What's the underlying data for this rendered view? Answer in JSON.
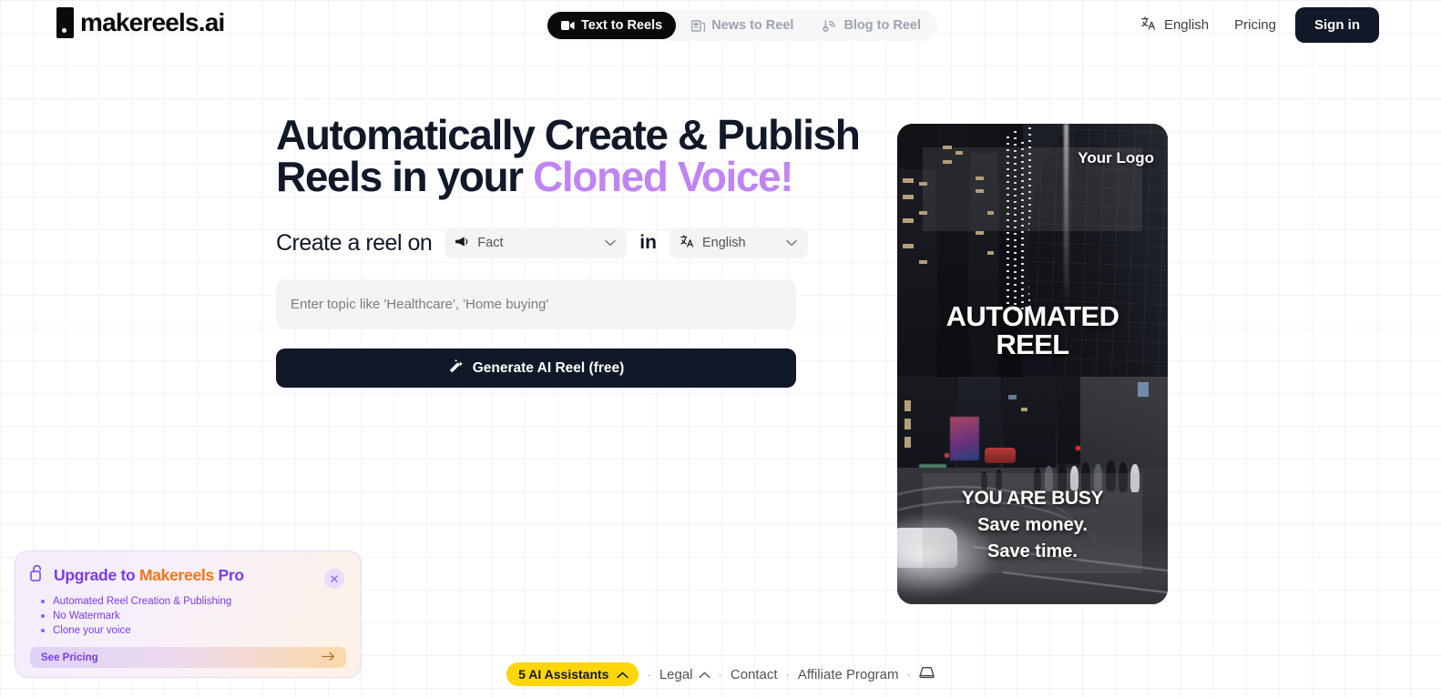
{
  "header": {
    "logo_text": "makereels.ai",
    "tabs": [
      {
        "label": "Text to Reels",
        "icon": "video-camera-icon",
        "active": true
      },
      {
        "label": "News to Reel",
        "icon": "newspaper-icon",
        "active": false
      },
      {
        "label": "Blog to Reel",
        "icon": "blog-rss-icon",
        "active": false
      }
    ],
    "language": "English",
    "pricing": "Pricing",
    "sign_in": "Sign in"
  },
  "hero": {
    "headline_line1": "Automatically Create & Publish",
    "headline_line2_prefix": "Reels in your ",
    "headline_accent": "Cloned Voice!",
    "accent_color": "#c084f5",
    "form": {
      "label_prefix": "Create a reel on",
      "topic_type": "Fact",
      "label_in": "in",
      "language": "English",
      "input_placeholder": "Enter topic like 'Healthcare', 'Home buying'",
      "input_value": "",
      "generate_label": "Generate AI Reel (free)"
    }
  },
  "video_preview": {
    "logo_watermark": "Your Logo",
    "title_line1": "AUTOMATED",
    "title_line2": "REEL",
    "caption_line1": "YOU ARE BUSY",
    "caption_line2": "Save money.",
    "caption_line3": "Save time."
  },
  "upgrade_card": {
    "title_prefix": "Upgrade to ",
    "brand": "Makereels",
    "pro": " Pro",
    "features": [
      "Automated Reel Creation & Publishing",
      "No Watermark",
      "Clone your voice"
    ],
    "cta": "See Pricing",
    "close": "✕",
    "title_color": "#7c3aed",
    "brand_color": "#f97316"
  },
  "footer": {
    "assistants": "5 AI Assistants",
    "links": [
      "Legal",
      "Contact",
      "Affiliate Program"
    ],
    "separator": "·",
    "pill_color": "#ffd60a"
  }
}
